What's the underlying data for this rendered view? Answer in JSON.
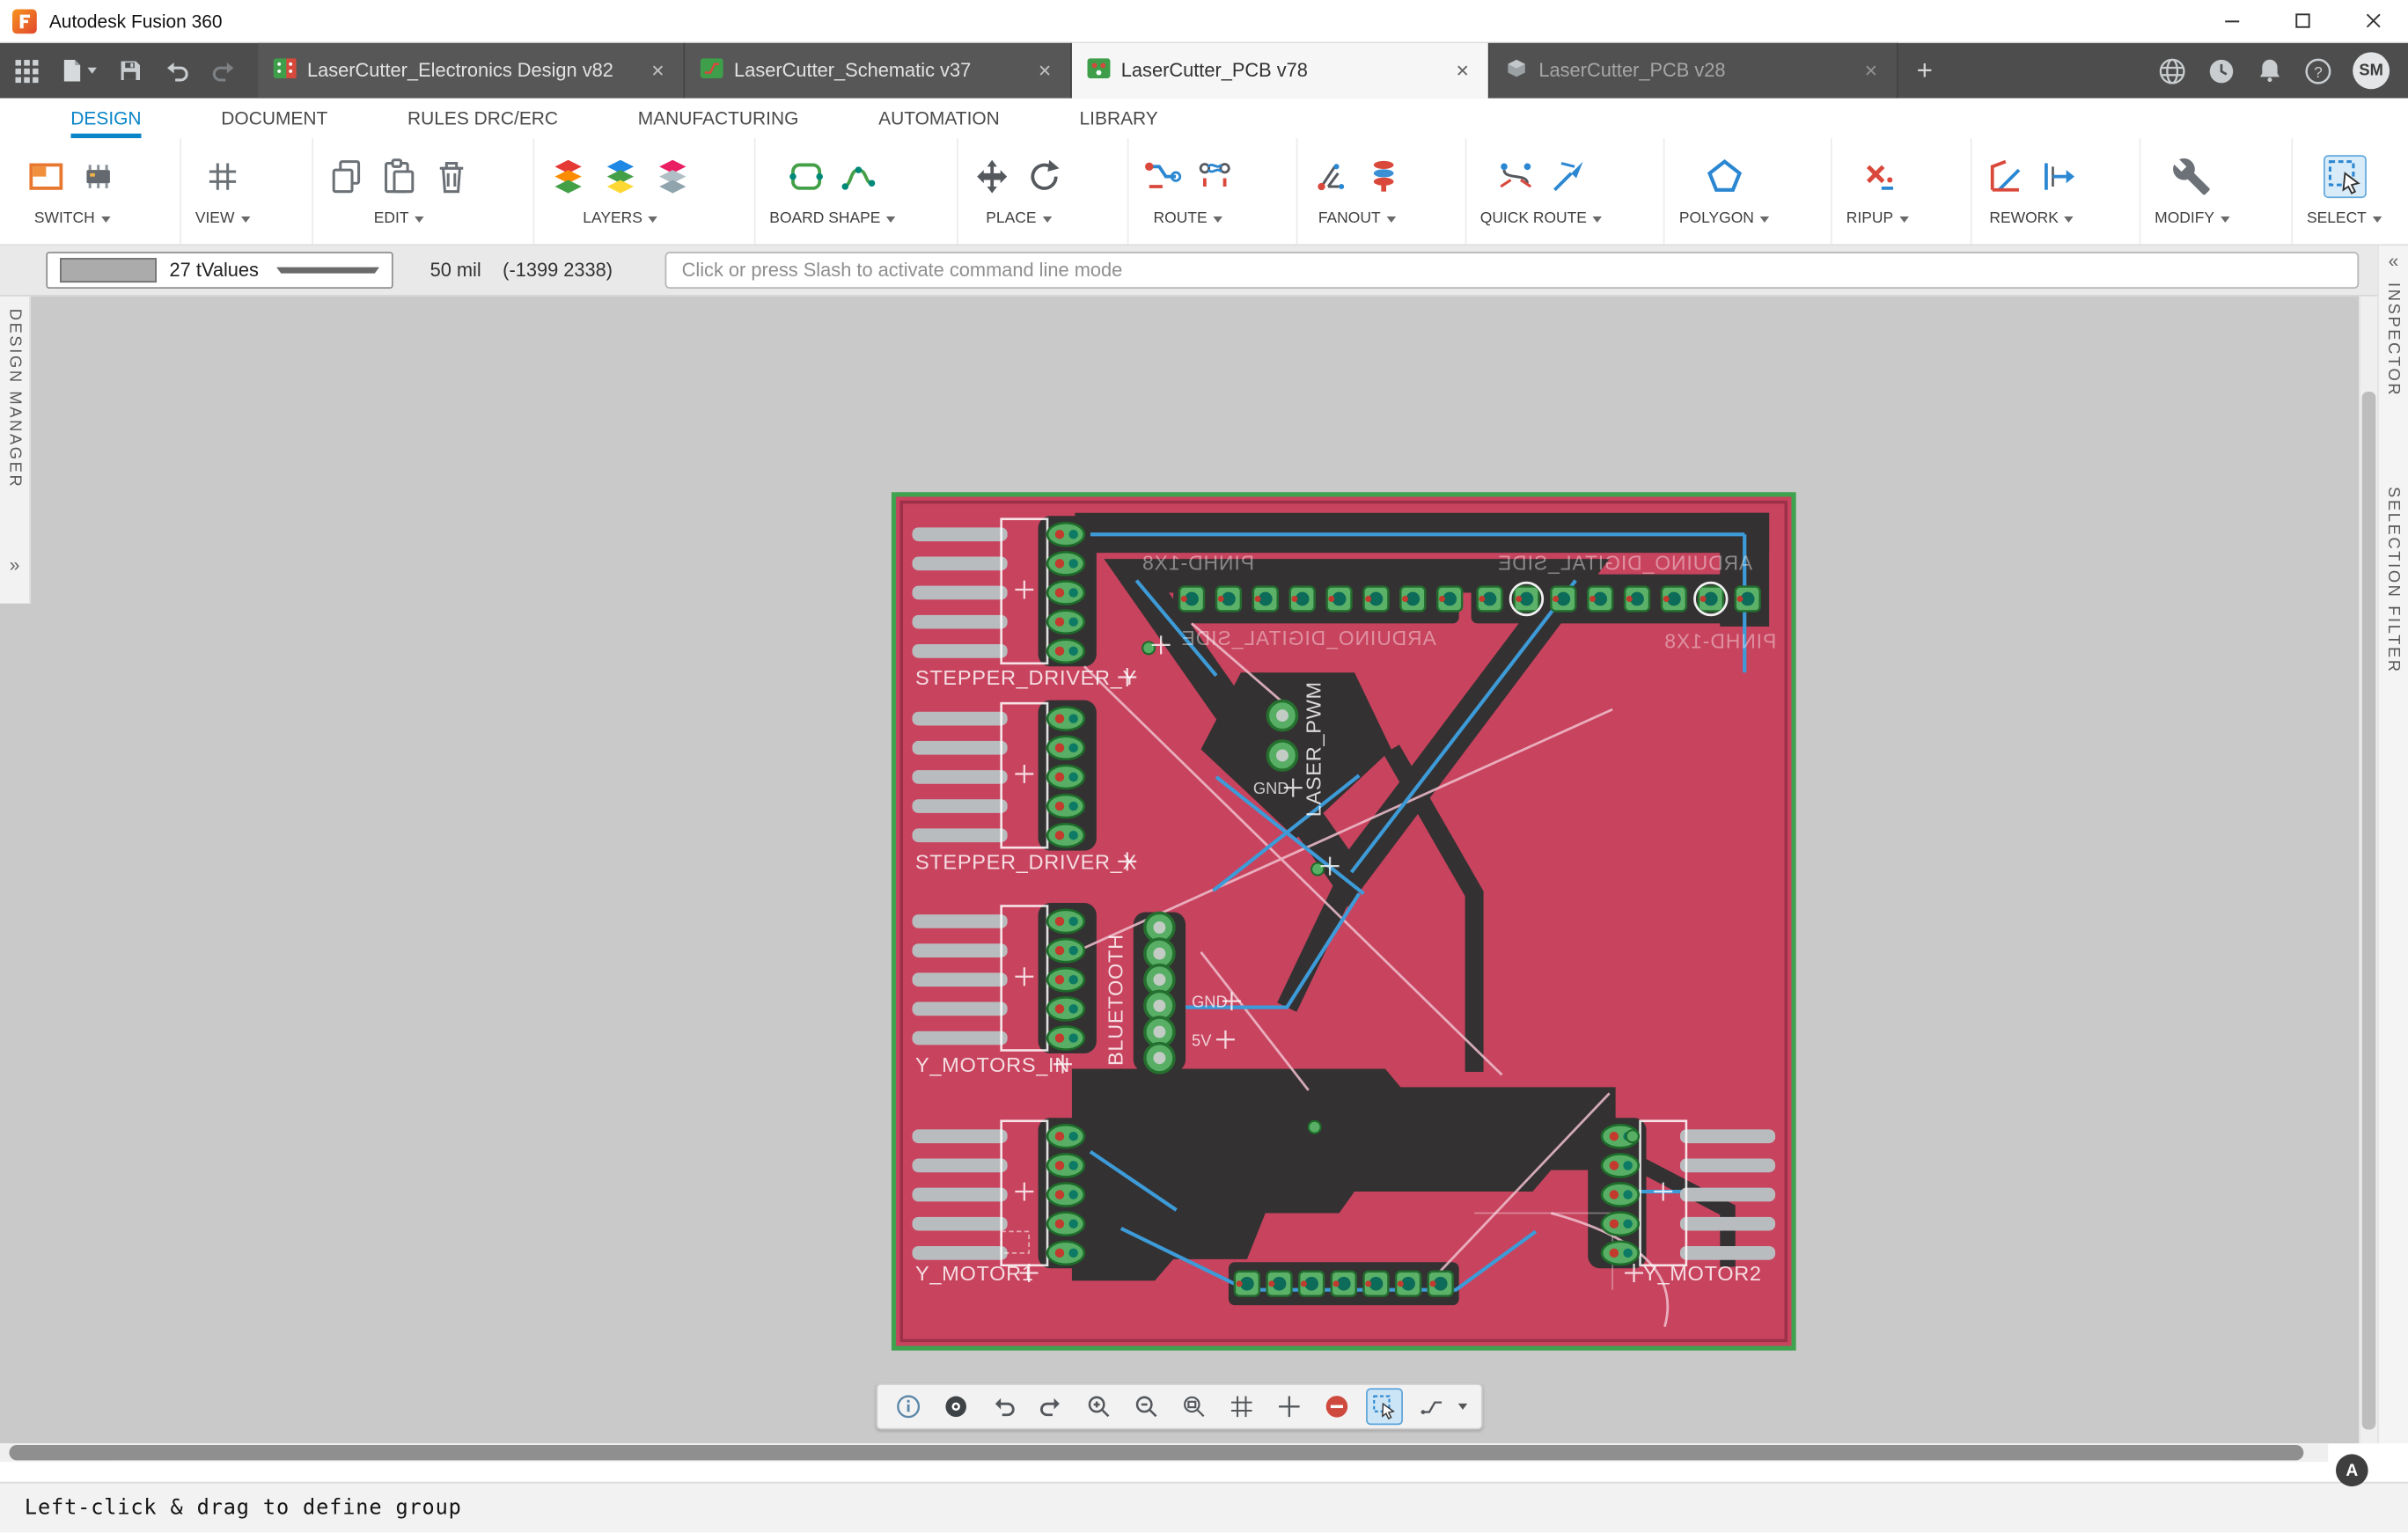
{
  "window": {
    "title": "Autodesk Fusion 360"
  },
  "tabbar": {
    "tabs": [
      {
        "label": "LaserCutter_Electronics Design v82"
      },
      {
        "label": "LaserCutter_Schematic v37"
      },
      {
        "label": "LaserCutter_PCB v78"
      },
      {
        "label": "LaserCutter_PCB v28"
      }
    ],
    "close_glyph": "✕",
    "new_tab_glyph": "+",
    "avatar_initials": "SM"
  },
  "menubar": {
    "items": [
      {
        "label": "DESIGN"
      },
      {
        "label": "DOCUMENT"
      },
      {
        "label": "RULES DRC/ERC"
      },
      {
        "label": "MANUFACTURING"
      },
      {
        "label": "AUTOMATION"
      },
      {
        "label": "LIBRARY"
      }
    ]
  },
  "toolbar": {
    "groups": [
      {
        "label": "SWITCH"
      },
      {
        "label": "VIEW"
      },
      {
        "label": "EDIT"
      },
      {
        "label": "LAYERS"
      },
      {
        "label": "BOARD SHAPE"
      },
      {
        "label": "PLACE"
      },
      {
        "label": "ROUTE"
      },
      {
        "label": "FANOUT"
      },
      {
        "label": "QUICK ROUTE"
      },
      {
        "label": "POLYGON"
      },
      {
        "label": "RIPUP"
      },
      {
        "label": "REWORK"
      },
      {
        "label": "MODIFY"
      },
      {
        "label": "SELECT"
      }
    ]
  },
  "commandbar": {
    "layer_value": "27 tValues",
    "grid": "50 mil",
    "position": "(-1399 2338)",
    "command_placeholder": "Click or press Slash to activate command line mode"
  },
  "panels": {
    "design_manager": "DESIGN MANAGER",
    "inspector": "INSPECTOR",
    "selection_filter": "SELECTION FILTER"
  },
  "statusbar": {
    "message": "Left-click & drag to define group"
  },
  "icons": {
    "help_glyph": "?",
    "autodesk_badge": "A",
    "expand_left_glyph": "»",
    "collapse_right_glyph": "«"
  },
  "pcb": {
    "labels": {
      "stepper_driver_y": "STEPPER_DRIVER_Y",
      "stepper_driver_x": "STEPPER_DRIVER_X",
      "y_motors_in": "Y_MOTORS_IN",
      "y_motor1": "Y_MOTOR1",
      "y_motor2": "Y_MOTOR2",
      "bluetooth": "BLUETOOTH",
      "laser_pwm": "LASER_PWM",
      "gnd_laser": "GND",
      "gnd_bluetooth": "GND",
      "v5_bluetooth": "5V",
      "mirrored_pinhd_left": "PINHD-1X8",
      "mirrored_arduino_right": "ARDUINO_DIGITAL_SIDE",
      "mirrored_arduino_left": "ARDUINO_DIGITAL_SIDE",
      "mirrored_pinhd_right": "PINHD-1X8"
    }
  }
}
